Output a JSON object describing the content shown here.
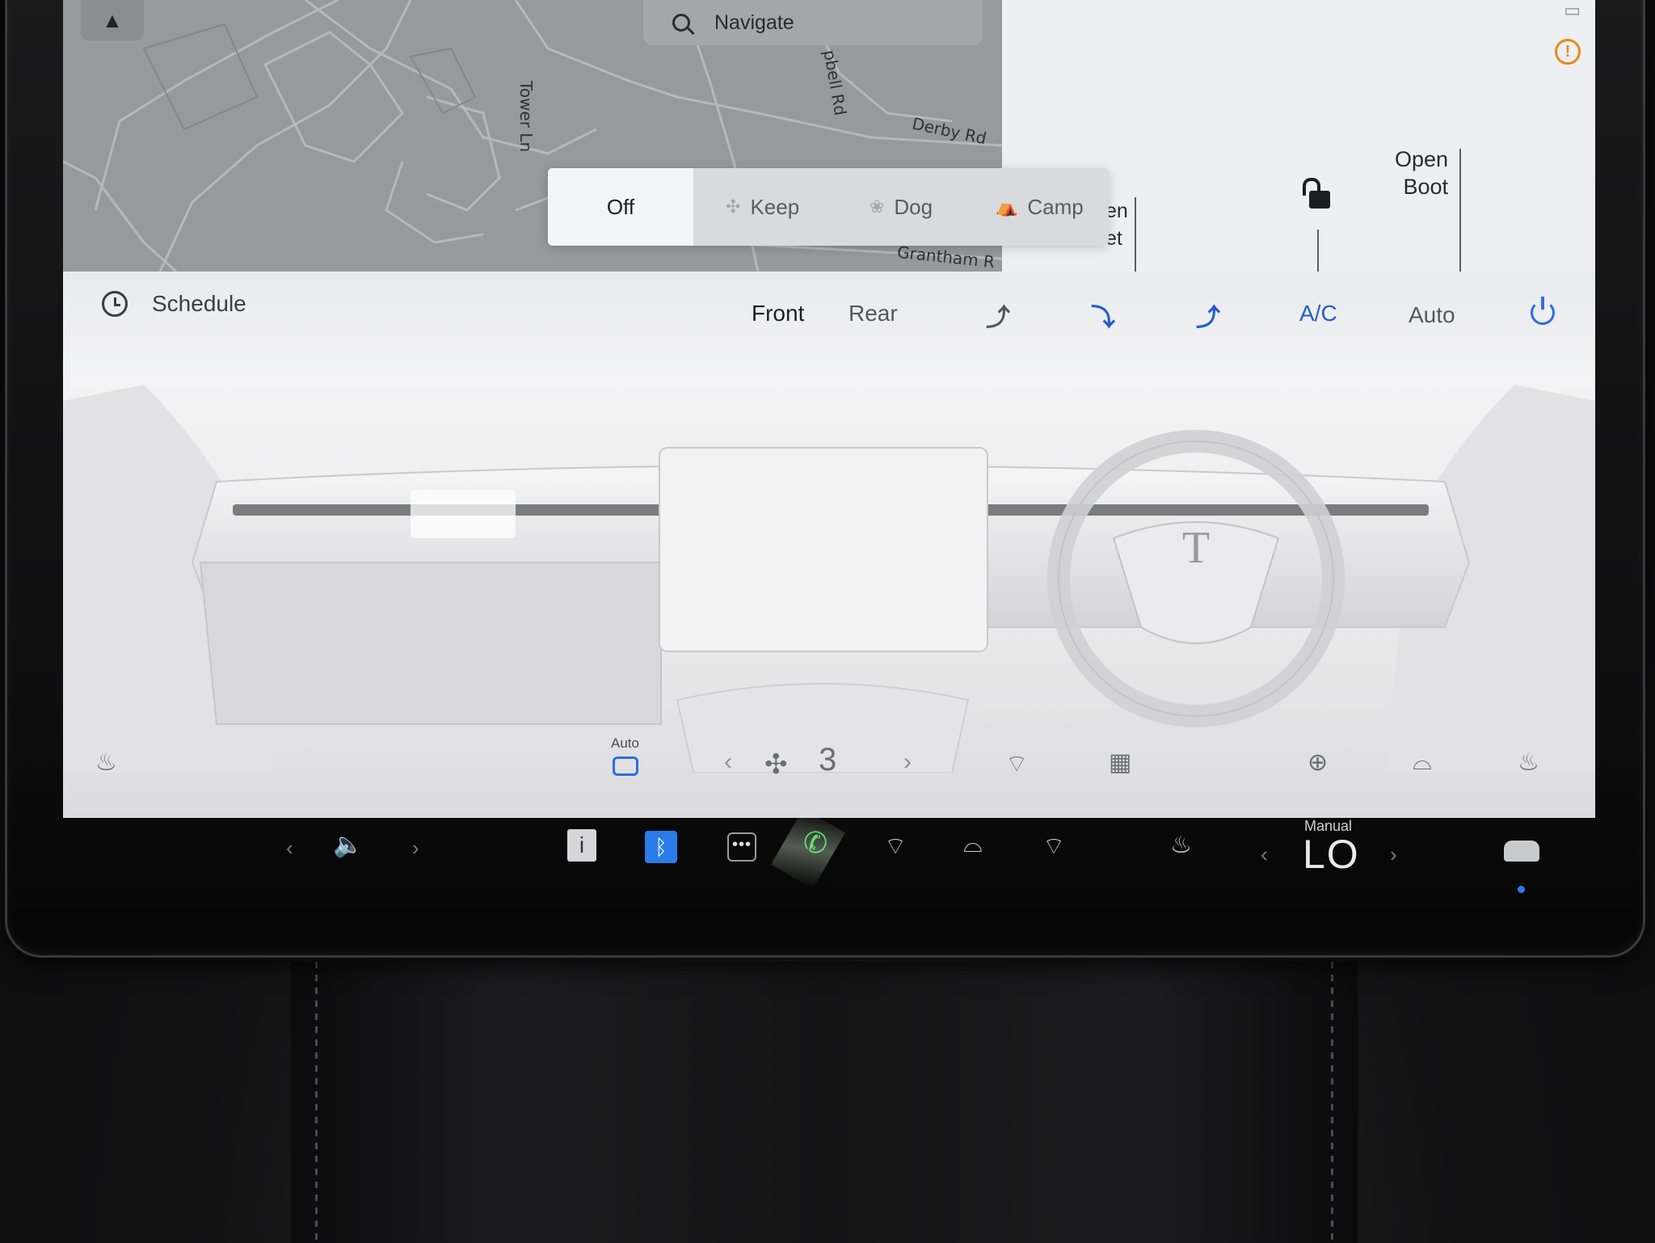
{
  "map": {
    "compass_glyph": "▲",
    "streets": {
      "tower_ln": "Tower Ln",
      "campbell_rd": "pbell Rd",
      "derby_rd": "Derby Rd",
      "grantham": "Grantham R"
    }
  },
  "search": {
    "placeholder": "Navigate"
  },
  "keep_climate": {
    "options": [
      {
        "label": "Off",
        "icon": ""
      },
      {
        "label": "Keep",
        "icon": "fan-icon"
      },
      {
        "label": "Dog",
        "icon": "paw-icon"
      },
      {
        "label": "Camp",
        "icon": "tent-icon"
      }
    ],
    "selected": "Off"
  },
  "vehicle_panel": {
    "frunk_label_line1": "en",
    "frunk_label_line2": "et",
    "boot_label_line1": "Open",
    "boot_label_line2": "Boot",
    "status_icons": [
      "display-icon",
      "warning-icon"
    ]
  },
  "climate": {
    "schedule_label": "Schedule",
    "tabs": {
      "front": "Front",
      "rear": "Rear",
      "selected": "Front"
    },
    "airflow_icons": [
      "airflow-face-icon",
      "airflow-feet-icon",
      "airflow-windshield-icon"
    ],
    "ac_label": "A/C",
    "auto_label": "Auto",
    "accent_color": "#1f5ecb",
    "recirc_label": "Auto",
    "fan_speed": "3",
    "bottom_icons": [
      "seat-heater-left-icon",
      "recirculate-icon",
      "fan-icon",
      "front-defrost-icon",
      "rear-defrost-icon",
      "steering-wheel-heater-icon",
      "wiper-heater-icon",
      "seat-heater-right-icon"
    ]
  },
  "taskbar": {
    "temperature_mode": "Manual",
    "temperature": "LO",
    "icons": [
      "volume-icon",
      "notes-icon",
      "bluetooth-icon",
      "more-icon",
      "phone-icon",
      "front-defrost-icon",
      "wiper-icon",
      "rear-defrost-icon",
      "seat-heater-icon",
      "car-icon"
    ]
  }
}
